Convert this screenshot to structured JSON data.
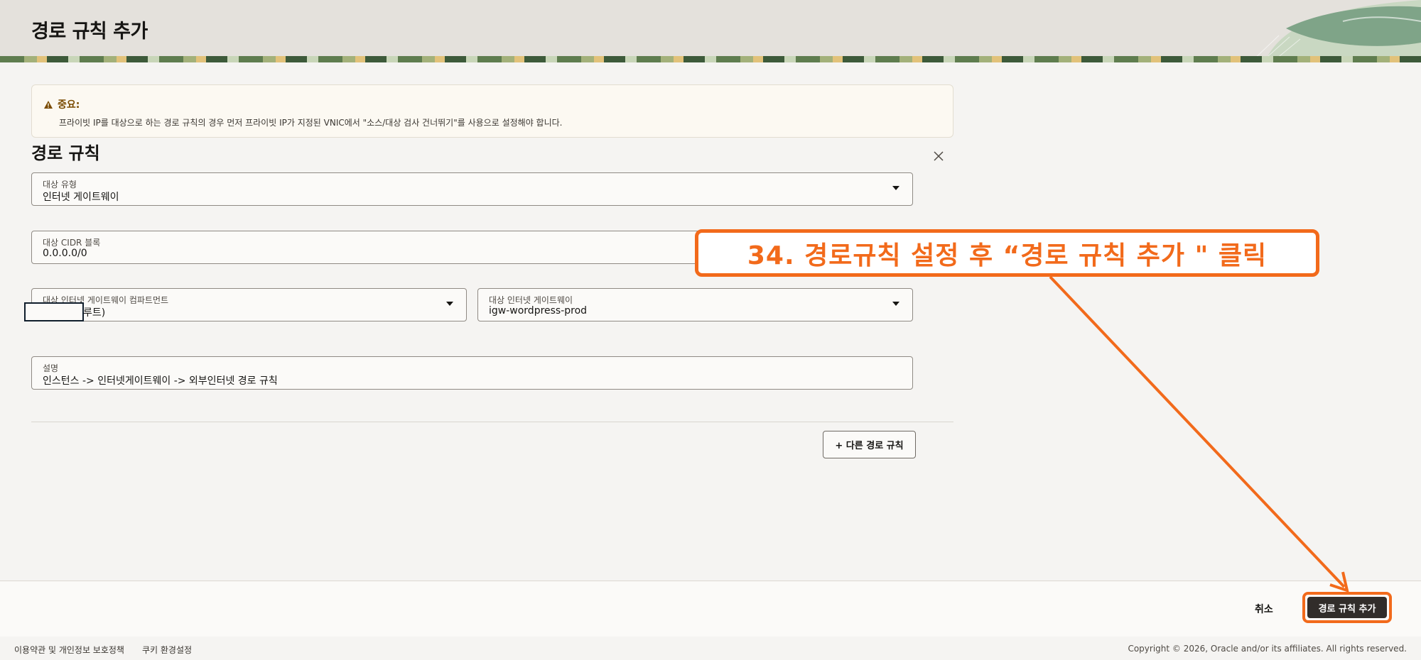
{
  "page": {
    "title": "경로 규칙 추가"
  },
  "notice": {
    "title": "중요:",
    "text": "프라이빗 IP를 대상으로 하는 경로 규칙의 경우 먼저 프라이빗 IP가 지정된 VNIC에서 \"소스/대상 검사 건너뛰기\"를 사용으로 설정해야 합니다."
  },
  "section": {
    "title": "경로 규칙"
  },
  "fields": {
    "target_type": {
      "label": "대상 유형",
      "value": "인터넷 게이트웨이"
    },
    "cidr": {
      "label": "대상 CIDR 블록",
      "value": "0.0.0.0/0"
    },
    "compartment": {
      "label": "대상 인터넷 게이트웨이 컴파트먼트",
      "value": "루트)"
    },
    "gateway": {
      "label": "대상 인터넷 게이트웨이",
      "value": "igw-wordpress-prod"
    },
    "description": {
      "label": "설명",
      "value": "인스턴스 -> 인터넷게이트웨이 -> 외부인터넷 경로 규칙"
    }
  },
  "buttons": {
    "add_another": "+ 다른 경로 규칙",
    "cancel": "취소",
    "submit": "경로 규칙 추가"
  },
  "footer": {
    "terms": "이용약관 및 개인정보 보호정책",
    "cookies": "쿠키 환경설정",
    "copyright": "Copyright © 2026, Oracle and/or its affiliates. All rights reserved."
  },
  "annotation": {
    "text": "34. 경로규칙 설정 후 “경로 규칙 추가 \"  클릭"
  },
  "colors": {
    "accent": "#f26a1b",
    "primary_button": "#312d2a",
    "header_bg": "#e4e1dc"
  },
  "icons": {
    "warning": "warning-icon",
    "close": "close-icon",
    "dropdown": "chevron-down-icon"
  }
}
